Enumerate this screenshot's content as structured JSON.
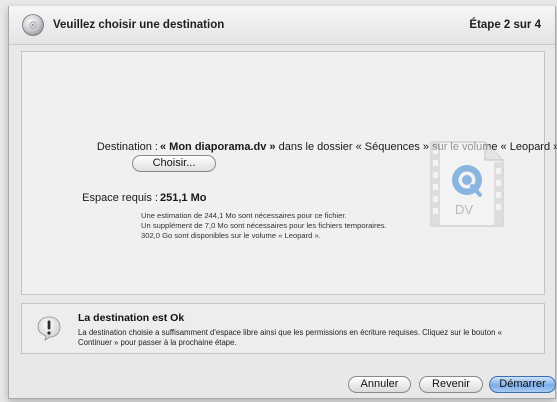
{
  "header": {
    "title": "Veuillez choisir une destination",
    "step": "Étape 2 sur 4"
  },
  "destination": {
    "label": "Destination :",
    "file": "« Mon diaporama.dv »",
    "middle": " dans le dossier « Séquences » sur le volume « Leopard »",
    "choose_button": "Choisir..."
  },
  "space": {
    "label": "Espace requis :",
    "value": "251,1 Mo",
    "details": [
      "Une estimation de 244,1 Mo sont nécessaires pour ce fichier.",
      "Un supplément de 7,0 Mo sont nécessaires pour les fichiers temporaires.",
      "302,0 Go sont disponibles sur le volume « Leopard »."
    ]
  },
  "file_icon": {
    "name": "dv-file-icon",
    "badge": "DV"
  },
  "alert": {
    "title": "La destination est Ok",
    "text": "La destination choisie a suffisamment d'espace libre ainsi que les permissions en écriture requises. Cliquez sur le bouton « Continuer » pour passer à la prochaine étape."
  },
  "buttons": {
    "cancel": "Annuler",
    "back": "Revenir",
    "start": "Démarrer"
  },
  "colors": {
    "accent": "#7eaee8",
    "quicktime": "#3a86d6"
  }
}
